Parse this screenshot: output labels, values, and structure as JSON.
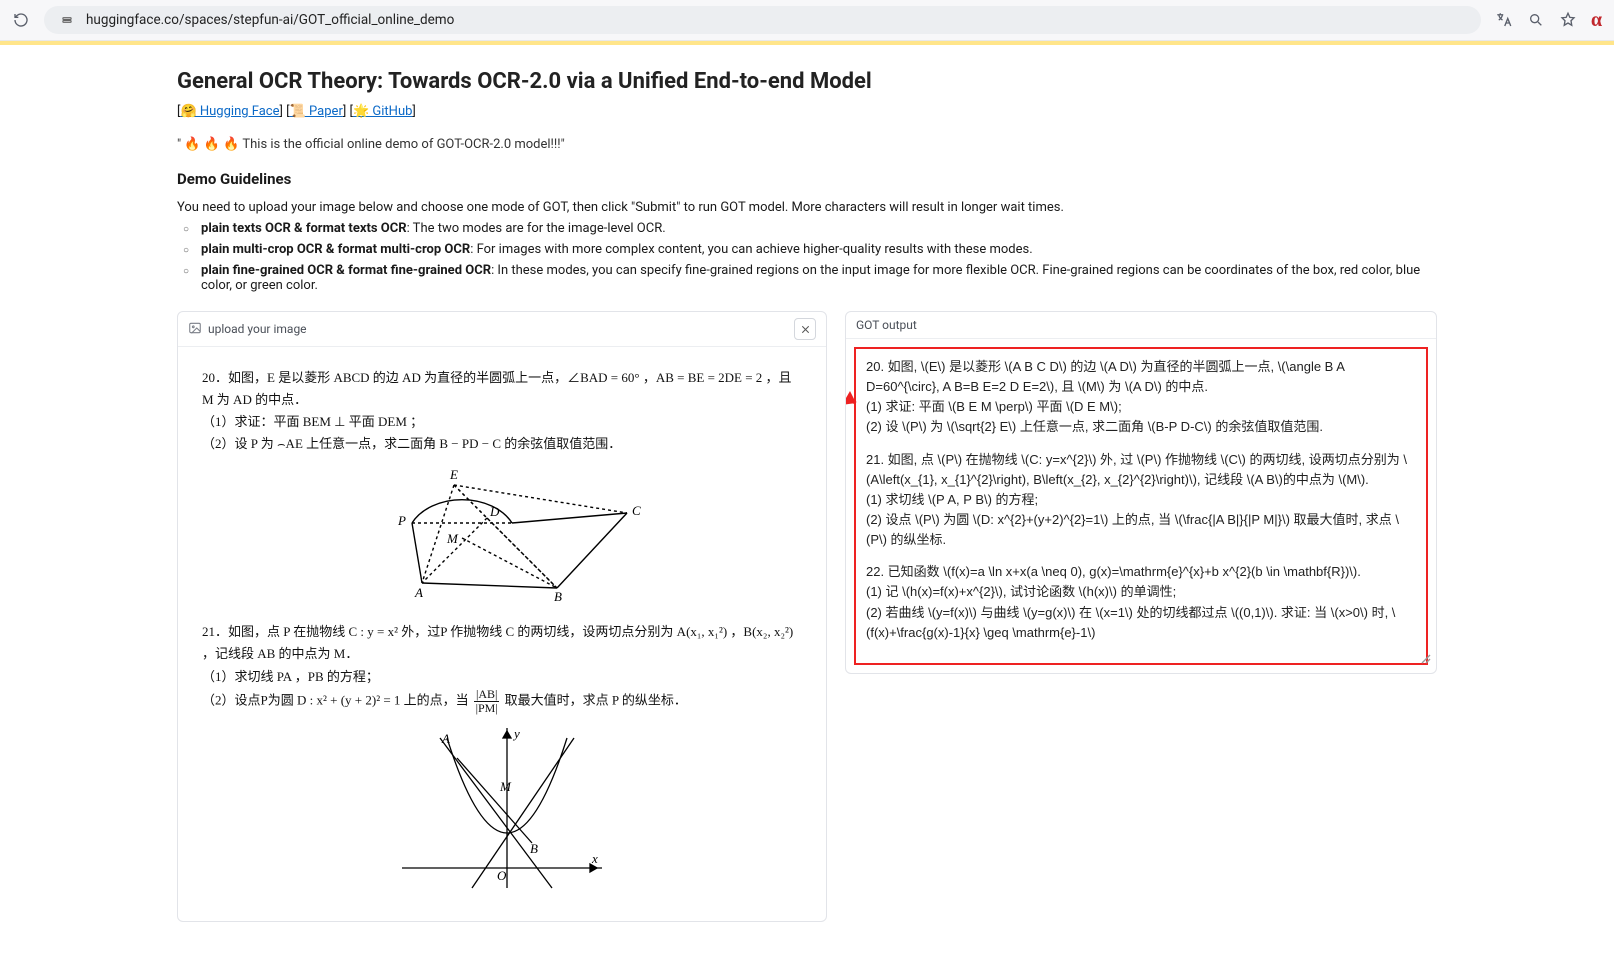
{
  "browser": {
    "url": "huggingface.co/spaces/stepfun-ai/GOT_official_online_demo"
  },
  "page": {
    "title": "General OCR Theory: Towards OCR-2.0 via a Unified End-to-end Model",
    "link_hf": "🤗  Hugging Face",
    "link_paper": "📜  Paper",
    "link_github": "🌟  GitHub",
    "tagline": "\" 🔥 🔥 🔥 This is the official online demo of GOT-OCR-2.0 model!!!\"",
    "guidelines_head": "Demo Guidelines",
    "guidelines_intro": "You need to upload your image below and choose one mode of GOT, then click \"Submit\" to run GOT model. More characters will result in longer wait times.",
    "guidelines": [
      {
        "bold": "plain texts OCR & format texts OCR",
        "rest": ": The two modes are for the image-level OCR."
      },
      {
        "bold": "plain multi-crop OCR & format multi-crop OCR",
        "rest": ": For images with more complex content, you can achieve higher-quality results with these modes."
      },
      {
        "bold": "plain fine-grained OCR & format fine-grained OCR",
        "rest": ": In these modes, you can specify fine-grained regions on the input image for more flexible OCR. Fine-grained regions can be coordinates of the box, red color, blue color, or green color."
      }
    ]
  },
  "left_panel": {
    "head": "upload your image",
    "p20_l1": "20．如图，E 是以菱形 ABCD 的边 AD 为直径的半圆弧上一点，∠BAD = 60° ，AB = BE = 2DE = 2 ，且 M 为 AD 的中点．",
    "p20_l2": "（1）求证：平面 BEM ⊥ 平面 DEM ；",
    "p20_l3": "（2）设 P 为 ⌢AE 上任意一点，求二面角 B − PD − C 的余弦值取值范围．",
    "p21_l1": "21．如图，点 P 在抛物线 C : y = x² 外，过P 作抛物线 C 的两切线，设两切点分别为 A(x₁, x₁²) ，B(x₂, x₂²) ，记线段 AB 的中点为 M．",
    "p21_l2": "（1）求切线 PA ，PB 的方程；",
    "p21_l3a": "（2）设点P为圆 D : x² + (y + 2)² = 1 上的点，当",
    "p21_frac_num": "|AB|",
    "p21_frac_den": "|PM|",
    "p21_l3b": "取最大值时，求点 P 的纵坐标．"
  },
  "right_panel": {
    "head": "GOT output",
    "par1": "20. 如图, \\(E\\) 是以菱形 \\(A B C D\\) 的边 \\(A D\\) 为直径的半圆弧上一点, \\(\\angle B A D=60^{\\circ}, A B=B E=2 D E=2\\), 且 \\(M\\) 为 \\(A D\\) 的中点.\n(1) 求证: 平面 \\(B E M \\perp\\) 平面 \\(D E M\\);\n(2) 设 \\(P\\) 为 \\(\\sqrt{2} E\\) 上任意一点, 求二面角 \\(B-P D-C\\) 的余弦值取值范围.",
    "par2": "21. 如图, 点 \\(P\\) 在抛物线 \\(C: y=x^{2}\\) 外, 过 \\(P\\) 作抛物线 \\(C\\) 的两切线, 设两切点分别为 \\(A\\left(x_{1}, x_{1}^{2}\\right), B\\left(x_{2}, x_{2}^{2}\\right)\\), 记线段 \\(A B\\)的中点为 \\(M\\).\n(1) 求切线 \\(P A, P B\\) 的方程;\n(2) 设点 \\(P\\) 为圆 \\(D: x^{2}+(y+2)^{2}=1\\) 上的点, 当 \\(\\frac{|A B|}{|P M|}\\) 取最大值时, 求点 \\(P\\) 的纵坐标.",
    "par3": "22. 已知函数 \\(f(x)=a \\ln x+x(a \\neq 0), g(x)=\\mathrm{e}^{x}+b x^{2}(b \\in \\mathbf{R})\\).\n(1) 记 \\(h(x)=f(x)+x^{2}\\), 试讨论函数 \\(h(x)\\) 的单调性;\n(2) 若曲线 \\(y=f(x)\\) 与曲线 \\(y=g(x)\\) 在 \\(x=1\\) 处的切线都过点 \\((0,1)\\). 求证: 当 \\(x>0\\) 时, \\(f(x)+\\frac{g(x)-1}{x} \\geq \\mathrm{e}-1\\)"
  }
}
